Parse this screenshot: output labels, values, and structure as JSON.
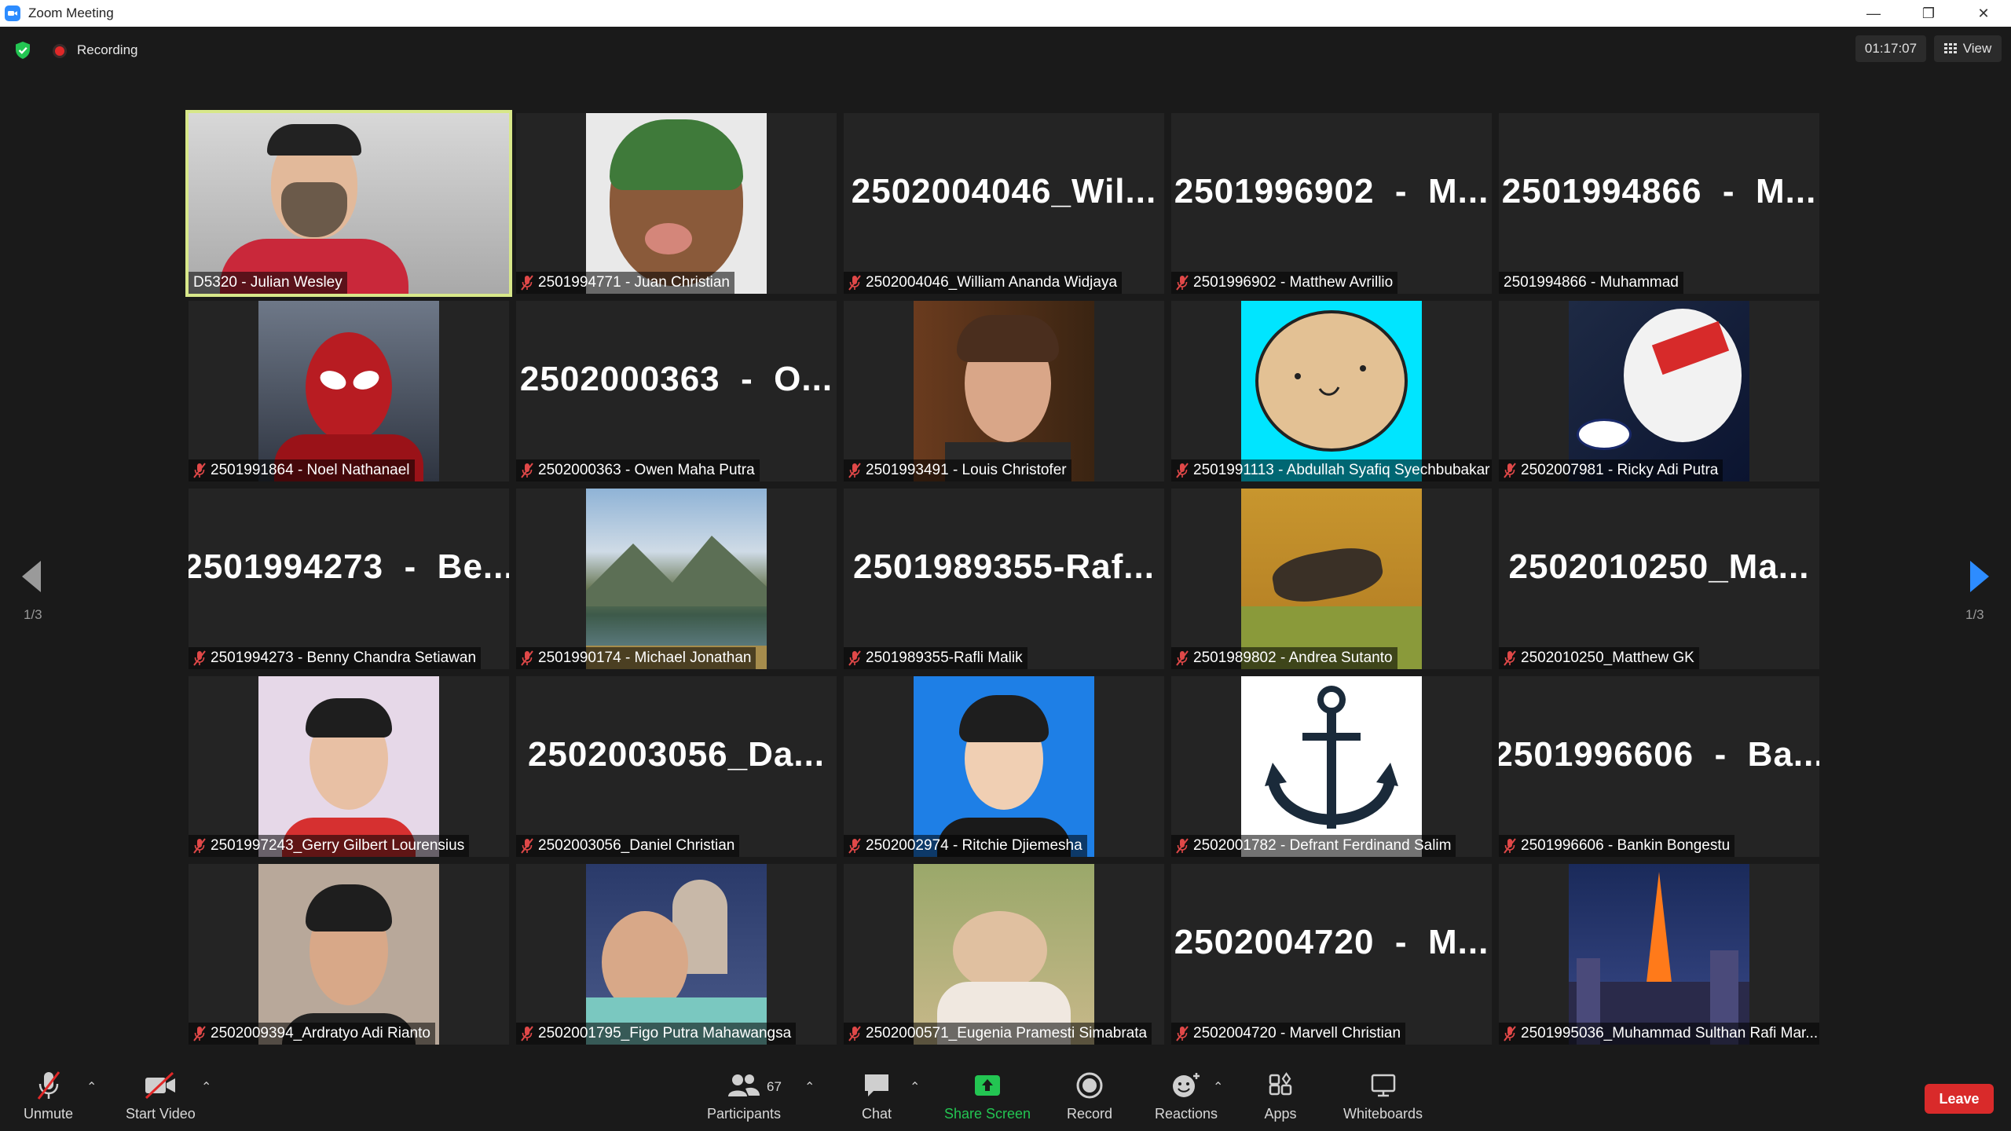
{
  "window": {
    "title": "Zoom Meeting"
  },
  "status": {
    "recording_label": "Recording",
    "timer": "01:17:07",
    "view_label": "View"
  },
  "pagination": {
    "left": "1/3",
    "right": "1/3"
  },
  "tiles": [
    {
      "big": "",
      "label": "D5320 - Julian Wesley",
      "muted": false,
      "pic": "masked-man-video"
    },
    {
      "big": "",
      "label": "2501994771 - Juan Christian",
      "muted": true,
      "pic": "cartoon-avatar"
    },
    {
      "big": "2502004046_Wil...",
      "label": "2502004046_William Ananda Widjaya",
      "muted": true
    },
    {
      "big": "2501996902  -  M...",
      "label": "2501996902 - Matthew Avrillio",
      "muted": true
    },
    {
      "big": "2501994866  -  M...",
      "label": "2501994866 - Muhammad",
      "muted": false
    },
    {
      "big": "",
      "label": "2501991864 - Noel Nathanael",
      "muted": true,
      "pic": "spiderman"
    },
    {
      "big": "2502000363  -  O...",
      "label": "2502000363 - Owen Maha Putra",
      "muted": true
    },
    {
      "big": "",
      "label": "2501993491 - Louis Christofer",
      "muted": true,
      "pic": "portrait-man"
    },
    {
      "big": "",
      "label": "2501991113 - Abdullah Syafiq Syechbubakar",
      "muted": true,
      "pic": "smiley-face"
    },
    {
      "big": "",
      "label": "2502007981 - Ricky Adi Putra",
      "muted": true,
      "pic": "racing-helmet"
    },
    {
      "big": "2501994273  -  Be...",
      "label": "2501994273 - Benny Chandra Setiawan",
      "muted": true
    },
    {
      "big": "",
      "label": "2501990174 - Michael Jonathan",
      "muted": true,
      "pic": "mountain-lake"
    },
    {
      "big": "2501989355-Raf...",
      "label": "2501989355-Rafli Malik",
      "muted": true
    },
    {
      "big": "",
      "label": "2501989802 - Andrea Sutanto",
      "muted": true,
      "pic": "game-scene"
    },
    {
      "big": "2502010250_Ma...",
      "label": "2502010250_Matthew GK",
      "muted": true
    },
    {
      "big": "",
      "label": "2501997243_Gerry Gilbert Lourensius",
      "muted": true,
      "pic": "id-photo-pink"
    },
    {
      "big": "2502003056_Da...",
      "label": "2502003056_Daniel Christian",
      "muted": true
    },
    {
      "big": "",
      "label": "2502002974 - Ritchie Djiemesha",
      "muted": true,
      "pic": "id-photo-blue"
    },
    {
      "big": "",
      "label": "2502001782 - Defrant Ferdinand Salim",
      "muted": true,
      "pic": "anchor"
    },
    {
      "big": "2501996606  -  Ba...",
      "label": "2501996606 - Bankin Bongestu",
      "muted": true
    },
    {
      "big": "",
      "label": "2502009394_Ardratyo Adi Rianto",
      "muted": true,
      "pic": "id-photo-brown"
    },
    {
      "big": "",
      "label": "2502001795_Figo Putra Mahawangsa",
      "muted": true,
      "pic": "arch-photo"
    },
    {
      "big": "",
      "label": "2502000571_Eugenia Pramesti Simabrata",
      "muted": true,
      "pic": "grass-photo"
    },
    {
      "big": "2502004720  -  M...",
      "label": "2502004720 - Marvell Christian",
      "muted": true
    },
    {
      "big": "",
      "label": "2501995036_Muhammad Sulthan Rafi Mar...",
      "muted": true,
      "pic": "tokyo-tower"
    }
  ],
  "toolbar": {
    "unmute": "Unmute",
    "start_video": "Start Video",
    "participants": "Participants",
    "participants_count": "67",
    "chat": "Chat",
    "share_screen": "Share Screen",
    "record": "Record",
    "reactions": "Reactions",
    "apps": "Apps",
    "whiteboards": "Whiteboards",
    "leave": "Leave"
  },
  "colors": {
    "accent_green": "#23c552",
    "leave_red": "#d92a2a",
    "active_border": "#d8e88a",
    "nav_blue": "#2d8cff"
  }
}
